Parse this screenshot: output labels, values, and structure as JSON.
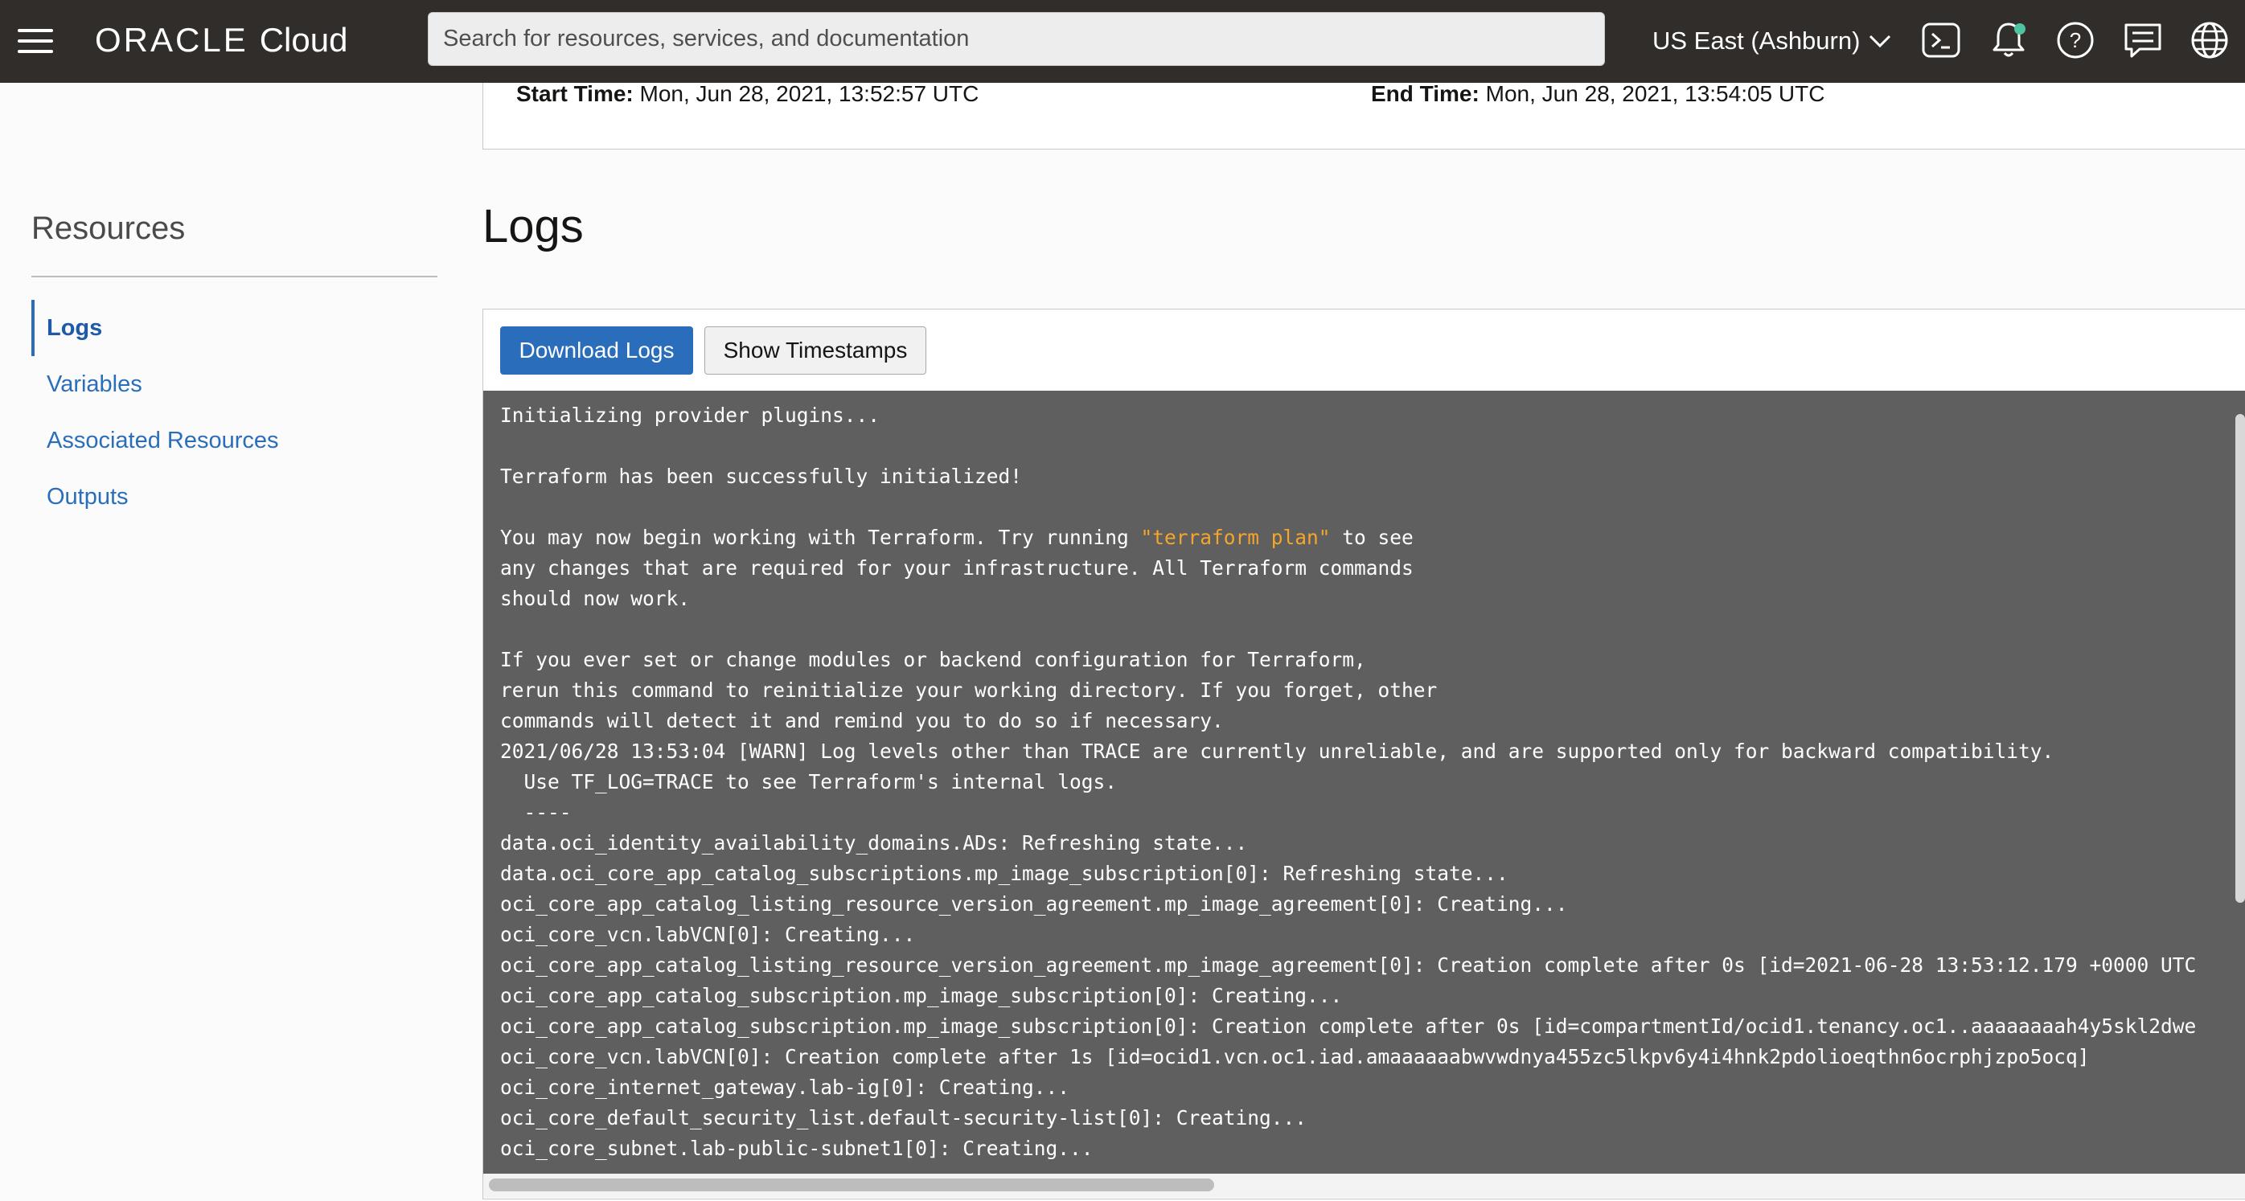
{
  "header": {
    "brand": "ORACLE",
    "product": "Cloud",
    "search_placeholder": "Search for resources, services, and documentation",
    "region": "US East (Ashburn)",
    "icons": [
      "cloud-shell-icon",
      "bell-icon",
      "help-icon",
      "chat-icon",
      "globe-icon"
    ],
    "notification_color": "#4fc3a1"
  },
  "job": {
    "start_label": "Start Time:",
    "start_value": "Mon, Jun 28, 2021, 13:52:57 UTC",
    "end_label": "End Time:",
    "end_value": "Mon, Jun 28, 2021, 13:54:05 UTC"
  },
  "sidebar": {
    "title": "Resources",
    "items": [
      {
        "label": "Logs",
        "active": true
      },
      {
        "label": "Variables",
        "active": false
      },
      {
        "label": "Associated Resources",
        "active": false
      },
      {
        "label": "Outputs",
        "active": false
      }
    ]
  },
  "main": {
    "title": "Logs",
    "download_label": "Download Logs",
    "timestamps_label": "Show Timestamps"
  },
  "log_lines": [
    {
      "text": "Initializing provider plugins..."
    },
    {
      "text": ""
    },
    {
      "text": "Terraform has been successfully initialized!"
    },
    {
      "text": ""
    },
    {
      "pre": "You may now begin working with Terraform. Try running ",
      "hl": "\"terraform plan\"",
      "post": " to see"
    },
    {
      "text": "any changes that are required for your infrastructure. All Terraform commands"
    },
    {
      "text": "should now work."
    },
    {
      "text": ""
    },
    {
      "text": "If you ever set or change modules or backend configuration for Terraform,"
    },
    {
      "text": "rerun this command to reinitialize your working directory. If you forget, other"
    },
    {
      "text": "commands will detect it and remind you to do so if necessary."
    },
    {
      "text": "2021/06/28 13:53:04 [WARN] Log levels other than TRACE are currently unreliable, and are supported only for backward compatibility."
    },
    {
      "text": "  Use TF_LOG=TRACE to see Terraform's internal logs."
    },
    {
      "text": "  ----"
    },
    {
      "text": "data.oci_identity_availability_domains.ADs: Refreshing state..."
    },
    {
      "text": "data.oci_core_app_catalog_subscriptions.mp_image_subscription[0]: Refreshing state..."
    },
    {
      "text": "oci_core_app_catalog_listing_resource_version_agreement.mp_image_agreement[0]: Creating..."
    },
    {
      "text": "oci_core_vcn.labVCN[0]: Creating..."
    },
    {
      "text": "oci_core_app_catalog_listing_resource_version_agreement.mp_image_agreement[0]: Creation complete after 0s [id=2021-06-28 13:53:12.179 +0000 UTC"
    },
    {
      "text": "oci_core_app_catalog_subscription.mp_image_subscription[0]: Creating..."
    },
    {
      "text": "oci_core_app_catalog_subscription.mp_image_subscription[0]: Creation complete after 0s [id=compartmentId/ocid1.tenancy.oc1..aaaaaaaah4y5skl2dwe"
    },
    {
      "text": "oci_core_vcn.labVCN[0]: Creation complete after 1s [id=ocid1.vcn.oc1.iad.amaaaaaabwvwdnya455zc5lkpv6y4i4hnk2pdolioeqthn6ocrphjzpo5ocq]"
    },
    {
      "text": "oci_core_internet_gateway.lab-ig[0]: Creating..."
    },
    {
      "text": "oci_core_default_security_list.default-security-list[0]: Creating..."
    },
    {
      "text": "oci_core_subnet.lab-public-subnet1[0]: Creating..."
    }
  ]
}
